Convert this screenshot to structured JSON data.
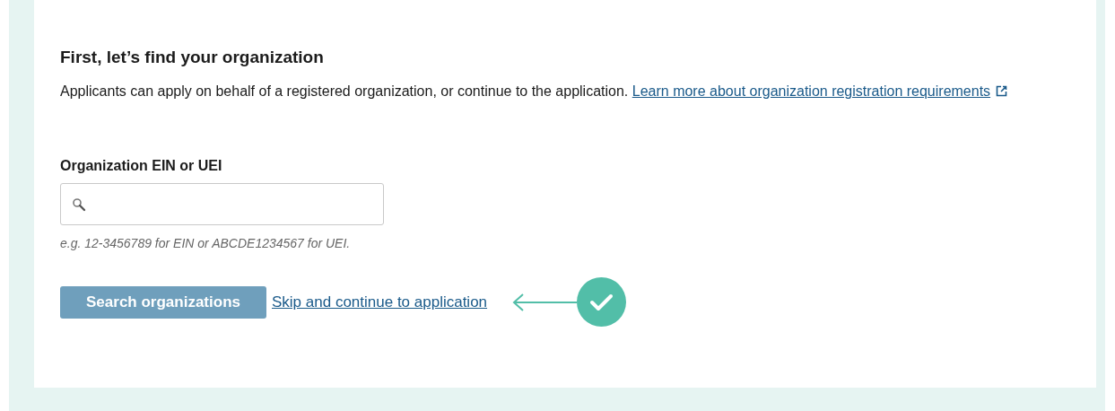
{
  "heading": "First, let’s find your organization",
  "intro": {
    "text": "Applicants can apply on behalf of a registered organization, or continue to the application.",
    "link": "Learn more about organization registration requirements"
  },
  "field": {
    "label": "Organization EIN or UEI",
    "hint": "e.g. 12-3456789 for EIN or ABCDE1234567 for UEI.",
    "disabled": false
  },
  "search_button": {
    "label": "Search organizations",
    "disabled": true
  },
  "skip_link": "Skip and continue to application"
}
